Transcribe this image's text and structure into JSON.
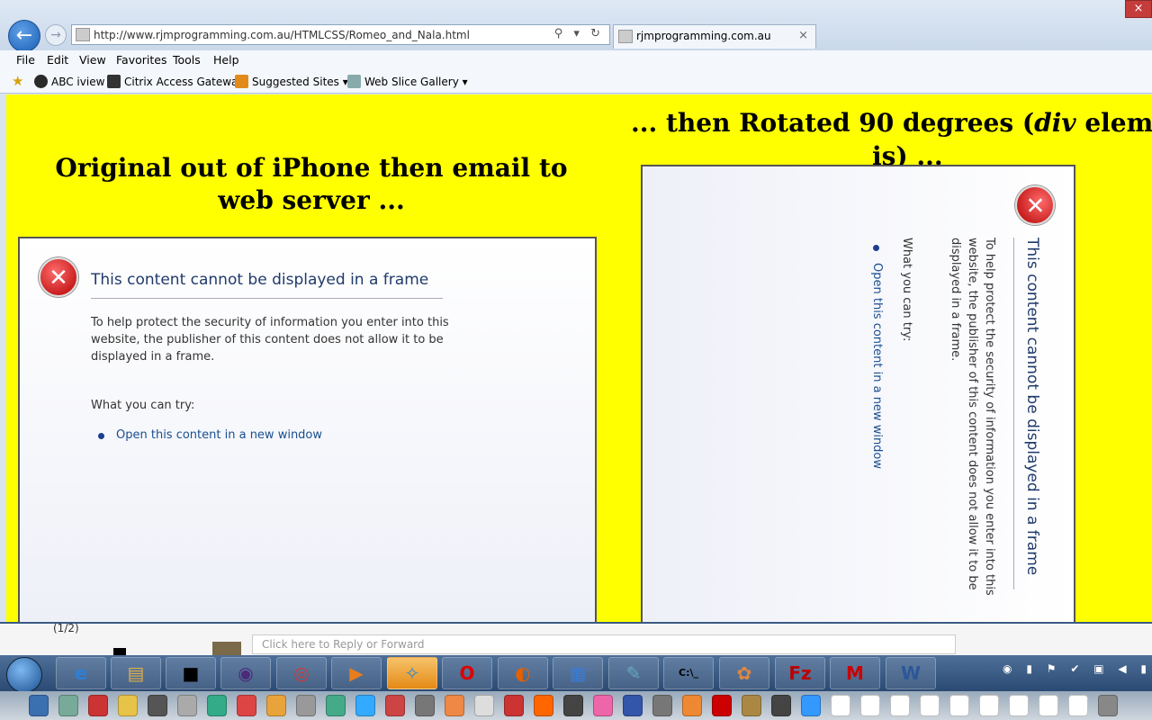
{
  "browser": {
    "url": "http://www.rjmprogramming.com.au/HTMLCSS/Romeo_and_Nala.html",
    "tab_title": "rjmprogramming.com.au",
    "tab_close": "×",
    "back_glyph": "←",
    "forward_glyph": "→",
    "address_icons": "⚲ ▾ ↻",
    "window_close": "×"
  },
  "menu": [
    "File",
    "Edit",
    "View",
    "Favorites",
    "Tools",
    "Help"
  ],
  "favorites": [
    {
      "label": "ABC iview",
      "icon": "abc-iview-icon",
      "color": "#2a2a2a"
    },
    {
      "label": "Citrix Access Gateway",
      "icon": "citrix-icon",
      "color": "#333"
    },
    {
      "label": "Suggested Sites ▾",
      "icon": "suggested-sites-icon",
      "color": "#e28b1b"
    },
    {
      "label": "Web Slice Gallery ▾",
      "icon": "web-slice-icon",
      "color": "#8aa"
    }
  ],
  "page": {
    "left_heading": "Original out of iPhone then email to web server ...",
    "right_heading_prefix": "... then Rotated 90 degrees (",
    "right_heading_em": "div",
    "right_heading_suffix": " element tha",
    "right_heading_line2": "is) ..."
  },
  "error_frame": {
    "icon_glyph": "✕",
    "title": "This content cannot be displayed in a frame",
    "description": "To help protect the security of information you enter into this website, the publisher of this content does not allow it to be displayed in a frame.",
    "try_label": "What you can try:",
    "link": "Open this content in a new window"
  },
  "email_strip": {
    "counter": "(1/2)",
    "reply_placeholder": "Click here to Reply or Forward"
  },
  "taskbar": {
    "items": [
      {
        "name": "internet-explorer",
        "glyph": "e",
        "color": "#2d7fd6"
      },
      {
        "name": "file-explorer",
        "glyph": "▤",
        "color": "#e0b04a"
      },
      {
        "name": "app-black",
        "glyph": "■",
        "color": "#000"
      },
      {
        "name": "eclipse",
        "glyph": "◉",
        "color": "#4b2a7a"
      },
      {
        "name": "chrome",
        "glyph": "◎",
        "color": "#d33"
      },
      {
        "name": "media-player",
        "glyph": "▶",
        "color": "#e87c1e"
      },
      {
        "name": "safari",
        "glyph": "✧",
        "color": "#2a8ad6"
      },
      {
        "name": "opera",
        "glyph": "O",
        "color": "#d00"
      },
      {
        "name": "firefox",
        "glyph": "◐",
        "color": "#e66000"
      },
      {
        "name": "control-panel",
        "glyph": "▦",
        "color": "#3a7bd5"
      },
      {
        "name": "notepad",
        "glyph": "✎",
        "color": "#6ab"
      },
      {
        "name": "command-prompt",
        "glyph": "C:\\_",
        "color": "#000"
      },
      {
        "name": "paint",
        "glyph": "✿",
        "color": "#d84"
      },
      {
        "name": "filezilla",
        "glyph": "Fz",
        "color": "#b00"
      },
      {
        "name": "mcafee",
        "glyph": "M",
        "color": "#c00"
      },
      {
        "name": "word",
        "glyph": "W",
        "color": "#2b579a"
      }
    ]
  },
  "dock_colors": [
    "#3a6fb0",
    "#7a9",
    "#c33",
    "#e8c34a",
    "#555",
    "#aaa",
    "#3a8",
    "#d44",
    "#e8a33a",
    "#999",
    "#4a8",
    "#3af",
    "#c44",
    "#777",
    "#e84",
    "#ddd",
    "#c33",
    "#f60",
    "#444",
    "#e6a",
    "#35a",
    "#777",
    "#e83",
    "#c00",
    "#a84",
    "#444",
    "#39f",
    "#fff",
    "#fff",
    "#fff",
    "#fff",
    "#fff",
    "#fff",
    "#fff",
    "#fff",
    "#fff",
    "#888"
  ]
}
